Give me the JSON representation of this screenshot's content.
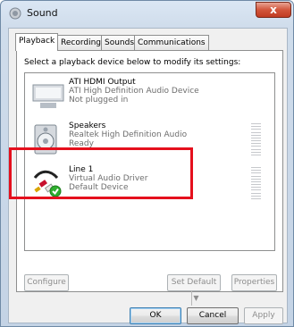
{
  "window": {
    "title": "Sound",
    "close_label": "x"
  },
  "tabs": [
    {
      "label": "Playback",
      "active": true
    },
    {
      "label": "Recording",
      "active": false
    },
    {
      "label": "Sounds",
      "active": false
    },
    {
      "label": "Communications",
      "active": false
    }
  ],
  "instruction": "Select a playback device below to modify its settings:",
  "devices": [
    {
      "name": "ATI HDMI Output",
      "line1": "ATI High Definition Audio Device",
      "line2": "Not plugged in",
      "icon": "monitor-icon"
    },
    {
      "name": "Speakers",
      "line1": "Realtek High Definition Audio",
      "line2": "Ready",
      "icon": "speaker-icon"
    },
    {
      "name": "Line 1",
      "line1": "Virtual Audio Driver",
      "line2": "Default Device",
      "icon": "audio-cable-icon"
    }
  ],
  "panel_buttons": {
    "configure": "Configure",
    "set_default": "Set Default",
    "properties": "Properties"
  },
  "dialog_buttons": {
    "ok": "OK",
    "cancel": "Cancel",
    "apply": "Apply"
  },
  "colors": {
    "highlight": "#e5101d",
    "close": "#c03b22",
    "default_check": "#2fae2f"
  }
}
